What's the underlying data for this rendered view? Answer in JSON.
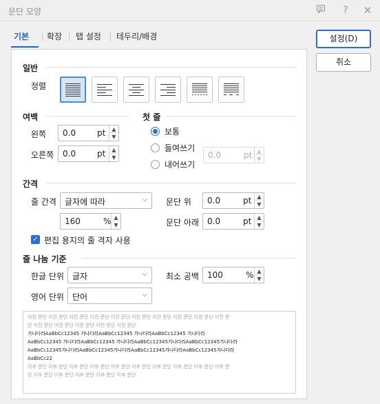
{
  "window": {
    "title": "문단 모양"
  },
  "tabs": [
    {
      "label": "기본"
    },
    {
      "label": "확장"
    },
    {
      "label": "탭 설정"
    },
    {
      "label": "테두리/배경"
    }
  ],
  "buttons": {
    "ok": "설정(D)",
    "cancel": "취소"
  },
  "general": {
    "title": "일반",
    "align_label": "정렬",
    "align_options": [
      "justify",
      "left",
      "center",
      "right",
      "distribute",
      "divide"
    ],
    "align_selected": "justify"
  },
  "margin": {
    "title": "여백",
    "left_label": "왼쪽",
    "left_value": "0.0",
    "left_unit": "pt",
    "right_label": "오른쪽",
    "right_value": "0.0",
    "right_unit": "pt"
  },
  "first_line": {
    "title": "첫 줄",
    "options": [
      {
        "label": "보통",
        "checked": true
      },
      {
        "label": "들여쓰기",
        "checked": false
      },
      {
        "label": "내어쓰기",
        "checked": false
      }
    ],
    "value": "0.0",
    "unit": "pt"
  },
  "spacing": {
    "title": "간격",
    "line_label": "줄 간격",
    "line_mode": "글자에 따라",
    "line_value": "160",
    "line_unit": "%",
    "above_label": "문단 위",
    "above_value": "0.0",
    "above_unit": "pt",
    "below_label": "문단 아래",
    "below_value": "0.0",
    "below_unit": "pt",
    "grid_label": "편집 용지의 줄 격자 사용",
    "grid_checked": true
  },
  "line_break": {
    "title": "줄 나눔 기준",
    "hangul_label": "한글 단위",
    "hangul_value": "글자",
    "min_space_label": "최소 공백",
    "min_space_value": "100",
    "min_space_unit": "%",
    "english_label": "영어 단위",
    "english_value": "단어"
  },
  "preview": {
    "prev_lines": [
      "이전 문단 이전 문단 이전 문단 이전 문단 이전 문단 이전 문단 이전 문단 이전 문단 이전 문단 이전 문",
      "단 이전 문단 이전 문단 이전 문단 이전 문단 이전 문단"
    ],
    "sample_lines": [
      "가나다라AaBbCc12345      가나다라AaBbCc12345      가나다라AaBbCc12345      가나다라",
      "AaBbCc12345  가나다라AaBbCc12345  가나다라AaBbCc12345가나다라AaBbCc12345가나다라",
      "AaBbCc12345가나다라AaBbCc12345가나다라AaBbCc12345가나다라AaBbCc12345가나다라",
      "AaBbCc22"
    ],
    "next_lines": [
      "이후 문단 이후 문단 이후 문단 이후 문단 이후 문단 이후 문단 이후 문단 이후 문단 이후 문단 이후 문",
      "단 이후 문단 이후 문단 이후 문단 이후 문단 이후 문단"
    ]
  },
  "icons": {
    "chat": "chat-icon",
    "help": "help-icon",
    "close": "close-icon"
  },
  "colors": {
    "accent": "#2a6fd0",
    "selected_bg": "#d6e5f7"
  }
}
